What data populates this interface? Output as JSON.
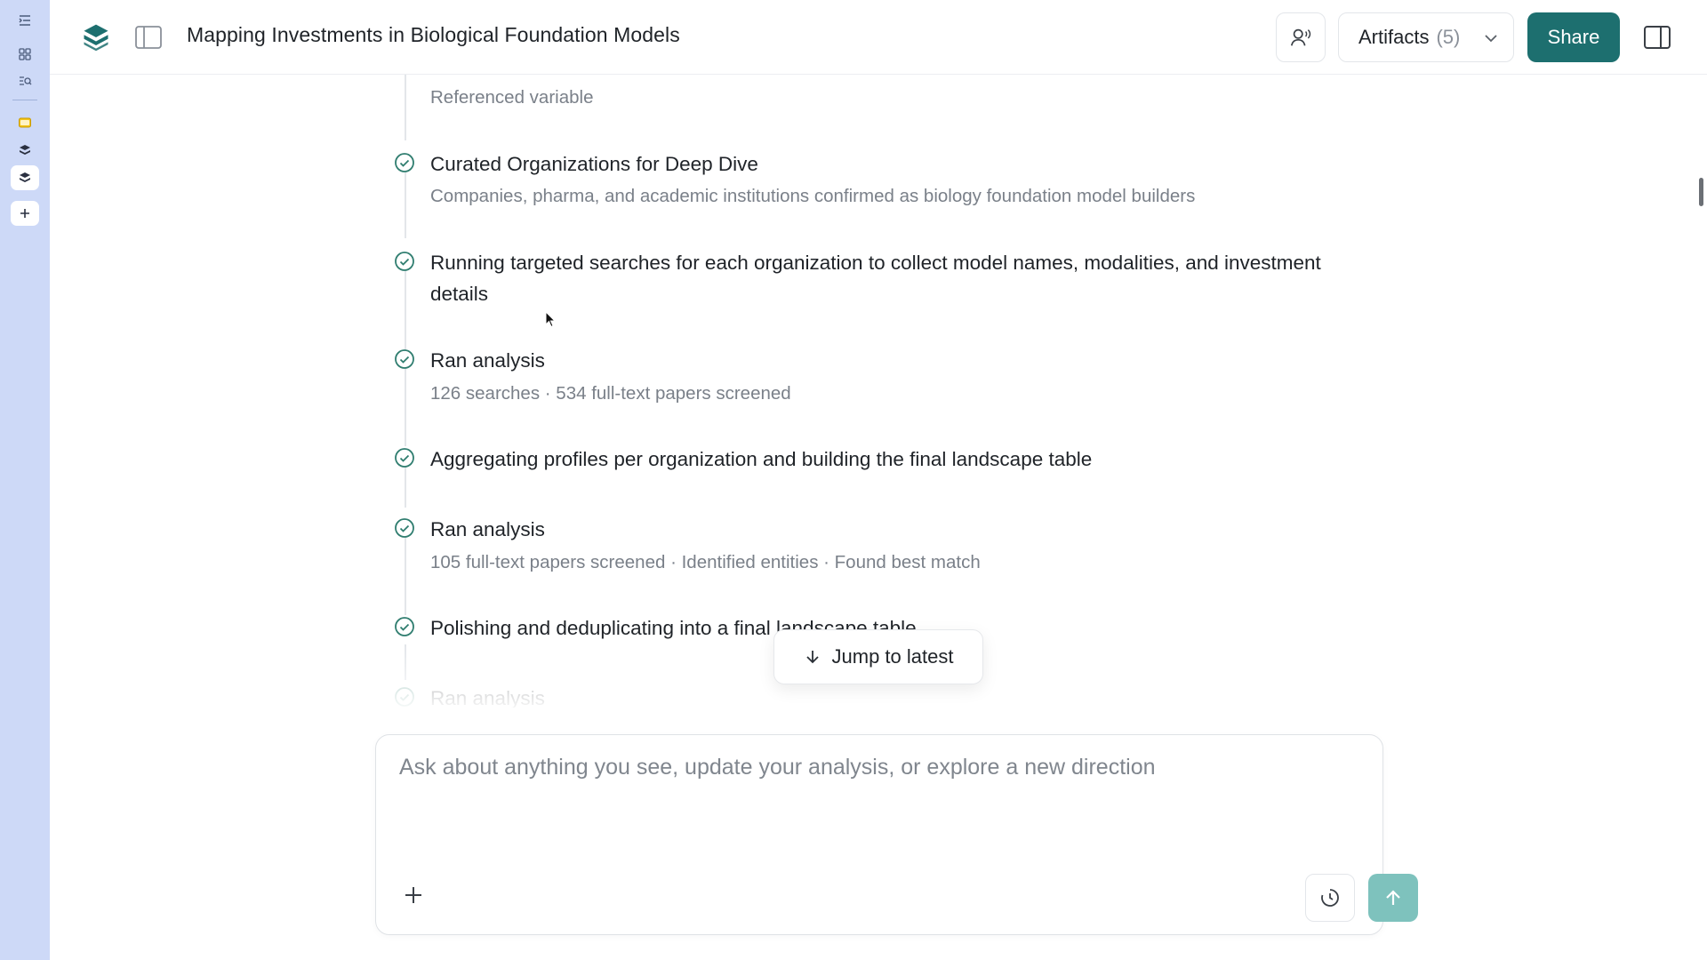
{
  "header": {
    "title": "Mapping Investments in Biological Foundation Models",
    "artifacts_label": "Artifacts",
    "artifacts_count": "(5)",
    "share_label": "Share"
  },
  "steps": [
    {
      "title": "",
      "subtitle": "Referenced variable"
    },
    {
      "title": "Curated Organizations for Deep Dive",
      "subtitle": "Companies, pharma, and academic institutions confirmed as biology foundation model builders"
    },
    {
      "title": "Running targeted searches for each organization to collect model names, modalities, and investment details",
      "subtitle": ""
    },
    {
      "title": "Ran analysis",
      "subtitle": "126 searches · 534 full-text papers screened"
    },
    {
      "title": "Aggregating profiles per organization and building the final landscape table",
      "subtitle": ""
    },
    {
      "title": "Ran analysis",
      "subtitle": "105 full-text papers screened · Identified entities · Found best match"
    },
    {
      "title": "Polishing and deduplicating into a final landscape table",
      "subtitle": ""
    },
    {
      "title": "Ran analysis",
      "subtitle": ""
    }
  ],
  "jump_label": "Jump to latest",
  "composer": {
    "placeholder": "Ask about anything you see, update your analysis, or explore a new direction"
  },
  "colors": {
    "accent": "#1d6f6f",
    "rail": "#cdd9f7",
    "send": "#7ec2bd",
    "check": "#2f7d6f"
  }
}
